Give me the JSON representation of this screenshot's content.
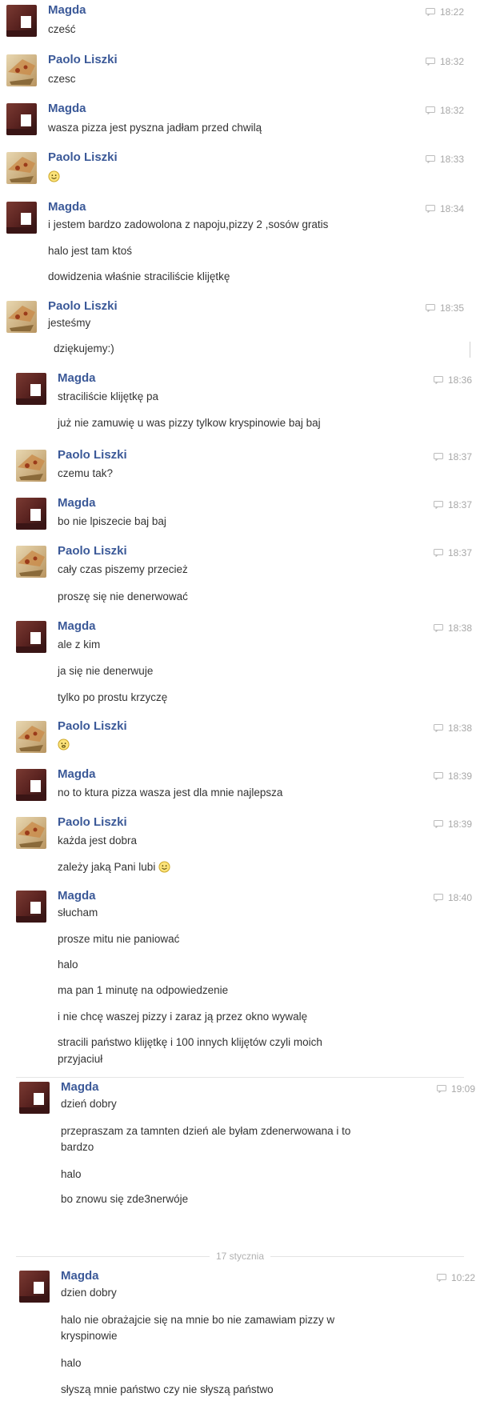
{
  "messages": [
    {
      "name": "Magda",
      "time": "18:22",
      "lines": [
        "cześć"
      ]
    },
    {
      "name": "Paolo Liszki",
      "time": "18:32",
      "lines": [
        "czesc"
      ]
    },
    {
      "name": "Magda",
      "time": "18:32",
      "lines": [
        "wasza pizza jest pyszna jadłam przed chwilą"
      ]
    },
    {
      "name": "Paolo Liszki",
      "time": "18:33",
      "lines": [
        ""
      ]
    },
    {
      "name": "Magda",
      "time": "18:34",
      "lines": [
        "i jestem bardzo zadowolona z napoju,pizzy 2 ,sosów gratis",
        "halo jest tam ktoś",
        "dowidzenia właśnie straciliście klijętkę"
      ]
    },
    {
      "name": "Paolo Liszki",
      "time": "18:35",
      "lines": [
        "jesteśmy",
        "dziękujemy:)"
      ]
    },
    {
      "name": "Magda",
      "time": "18:36",
      "lines": [
        "straciliście klijętkę pa",
        "już nie zamuwię u was pizzy tylkow kryspinowie baj baj"
      ]
    },
    {
      "name": "Paolo Liszki",
      "time": "18:37",
      "lines": [
        "czemu tak?"
      ]
    },
    {
      "name": "Magda",
      "time": "18:37",
      "lines": [
        "bo nie lpiszecie baj baj"
      ]
    },
    {
      "name": "Paolo Liszki",
      "time": "18:37",
      "lines": [
        "cały czas piszemy przecież",
        "proszę się nie denerwować"
      ]
    },
    {
      "name": "Magda",
      "time": "18:38",
      "lines": [
        "ale z kim",
        "ja się nie denerwuje",
        "tylko po prostu krzyczę"
      ]
    },
    {
      "name": "Paolo Liszki",
      "time": "18:38",
      "lines": [
        ""
      ]
    },
    {
      "name": "Magda",
      "time": "18:39",
      "lines": [
        "no to ktura pizza wasza jest dla mnie najlepsza"
      ]
    },
    {
      "name": "Paolo Liszki",
      "time": "18:39",
      "lines": [
        "każda jest dobra",
        "zależy jaką Pani lubi"
      ]
    },
    {
      "name": "Magda",
      "time": "18:40",
      "lines": [
        "słucham",
        "prosze mitu nie paniować",
        "halo",
        "ma pan 1 minutę na odpowiedzenie",
        "i nie chcę waszej pizzy i zaraz ją przez okno wywalę",
        "stracili państwo klijętkę i 100 innych klijętów czyli moich",
        "przyjaciuł"
      ]
    },
    {
      "name": "Magda",
      "time": "19:09",
      "lines": [
        "dzień dobry",
        "przepraszam za tamnten dzień ale byłam zdenerwowana i to",
        "bardzo",
        "halo",
        "bo znowu się zde3nerwóje"
      ]
    },
    {
      "name": "Magda",
      "time": "10:22",
      "lines": [
        "dzien dobry",
        "halo nie obrażajcie się na mnie bo nie zamawiam pizzy w",
        "kryspinowie",
        "halo",
        "słyszą mnie państwo czy nie słyszą państwo"
      ]
    }
  ],
  "date_separator": "17 stycznia",
  "emoji": {
    "smile": "smiley-icon",
    "neutral": "neutral-face-icon"
  },
  "colors": {
    "name": "#3b5998",
    "text": "#333333",
    "time": "#a8a8a8"
  }
}
